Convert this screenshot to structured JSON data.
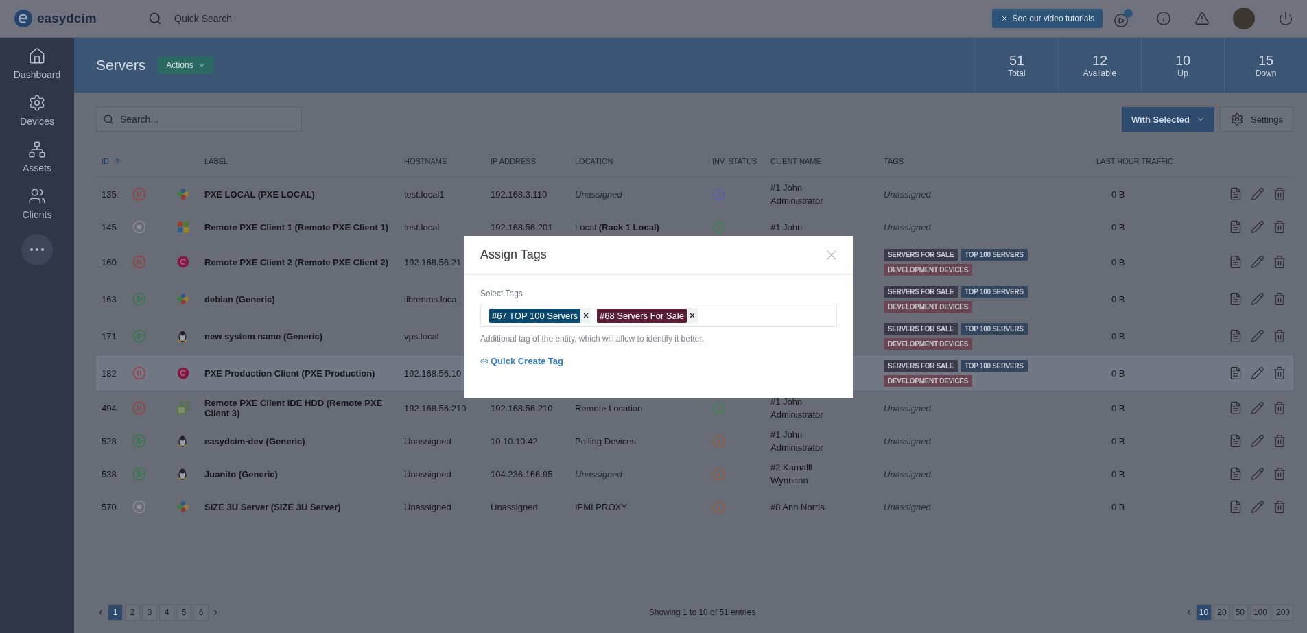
{
  "topbar": {
    "logo": "easydcim",
    "search": {
      "placeholder": "Quick Search"
    },
    "tutorial_button": "See our video tutorials"
  },
  "sidebar": {
    "items": [
      {
        "label": "Dashboard",
        "kind": "home"
      },
      {
        "label": "Devices",
        "kind": "gear"
      },
      {
        "label": "Assets",
        "kind": "network"
      },
      {
        "label": "Clients",
        "kind": "users"
      }
    ]
  },
  "page_header": {
    "title": "Servers",
    "actions_button": "Actions",
    "stats": [
      {
        "value": "51",
        "label": "Total"
      },
      {
        "value": "12",
        "label": "Available"
      },
      {
        "value": "10",
        "label": "Up"
      },
      {
        "value": "15",
        "label": "Down"
      }
    ]
  },
  "toolbar": {
    "search": {
      "placeholder": "Search..."
    },
    "with_selected_button": "With Selected",
    "settings_button": "Settings"
  },
  "table": {
    "columns": [
      {
        "label": "ID",
        "sorted": true,
        "kind": "id"
      },
      {
        "label": "LABEL",
        "sorted": false,
        "kind": "label"
      },
      {
        "label": "HOSTNAME",
        "sorted": false,
        "kind": "hostname"
      },
      {
        "label": "IP ADDRESS",
        "sorted": false,
        "kind": "ip"
      },
      {
        "label": "LOCATION",
        "sorted": false,
        "kind": "location"
      },
      {
        "label": "INV. STATUS",
        "sorted": false,
        "kind": "inv"
      },
      {
        "label": "CLIENT NAME",
        "sorted": false,
        "kind": "client"
      },
      {
        "label": "TAGS",
        "sorted": false,
        "kind": "tags"
      },
      {
        "label": "LAST HOUR TRAFFIC",
        "sorted": false,
        "kind": "traffic"
      }
    ],
    "rows": [
      {
        "id": "135",
        "status_icon": {
          "kind": "paused"
        },
        "os_icon": {
          "kind": "pinwheel"
        },
        "label": "PXE LOCAL (PXE LOCAL)",
        "hostname": "test.local1",
        "ip": "192.168.3.110",
        "location": "Unassigned",
        "location_assigned": false,
        "inv_status": {
          "color": "#5b57c9"
        },
        "client": "#1 John Administrator",
        "tags": [],
        "tags_empty": "Unassigned",
        "traffic": "0 B",
        "highlighted": false
      },
      {
        "id": "145",
        "status_icon": {
          "kind": "stopped"
        },
        "os_icon": {
          "kind": "windows"
        },
        "label": "Remote PXE Client 1 (Remote PXE Client 1)",
        "hostname": "test.local",
        "ip": "192.168.56.201",
        "location": "Local **(Rack 1 Local)**",
        "location_assigned": true,
        "inv_status": {
          "color": "#2e8a48"
        },
        "client": "#1 John",
        "tags": [],
        "tags_empty": "Unassigned",
        "traffic": "0 B",
        "highlighted": false
      },
      {
        "id": "160",
        "status_icon": {
          "kind": "paused"
        },
        "os_icon": {
          "kind": "swirl"
        },
        "label": "Remote PXE Client 2 (Remote PXE Client 2)",
        "hostname": "192.168.56.21",
        "tags": [
          {
            "label": "SERVERS FOR SALE",
            "color": "#3b3a4b"
          },
          {
            "label": "TOP 100 SERVERS",
            "color": "#33465f"
          },
          {
            "label": "DEVELOPMENT DEVICES",
            "color": "#6b4652"
          }
        ],
        "traffic": "0 B",
        "highlighted": false
      },
      {
        "id": "163",
        "status_icon": {
          "kind": "running"
        },
        "os_icon": {
          "kind": "pinwheel"
        },
        "label": "debian (Generic)",
        "hostname": "librenms.loca",
        "tags": [
          {
            "label": "SERVERS FOR SALE",
            "color": "#3b3a4b"
          },
          {
            "label": "TOP 100 SERVERS",
            "color": "#33465f"
          },
          {
            "label": "DEVELOPMENT DEVICES",
            "color": "#6b4652"
          }
        ],
        "traffic": "0 B",
        "highlighted": false
      },
      {
        "id": "171",
        "status_icon": {
          "kind": "running"
        },
        "os_icon": {
          "kind": "penguin"
        },
        "label": "new system name (Generic)",
        "hostname": "vps.local",
        "tags": [
          {
            "label": "SERVERS FOR SALE",
            "color": "#3b3a4b"
          },
          {
            "label": "TOP 100 SERVERS",
            "color": "#33465f"
          },
          {
            "label": "DEVELOPMENT DEVICES",
            "color": "#6b4652"
          }
        ],
        "traffic": "0 B",
        "highlighted": false
      },
      {
        "id": "182",
        "status_icon": {
          "kind": "paused"
        },
        "os_icon": {
          "kind": "swirl"
        },
        "label": "PXE Production Client (PXE Production)",
        "hostname": "192.168.56.10",
        "tags": [
          {
            "label": "SERVERS FOR SALE",
            "color": "#3b3a4b"
          },
          {
            "label": "TOP 100 SERVERS",
            "color": "#33465f"
          },
          {
            "label": "DEVELOPMENT DEVICES",
            "color": "#6b4652"
          }
        ],
        "traffic": "0 B",
        "highlighted": true
      },
      {
        "id": "494",
        "status_icon": {
          "kind": "paused"
        },
        "os_icon": {
          "kind": "squares"
        },
        "label": "Remote PXE Client IDE HDD (Remote PXE Client 3)",
        "hostname": "192.168.56.210",
        "ip": "192.168.56.210",
        "location": "Remote Location",
        "location_assigned": true,
        "inv_status": {
          "color": "#2e8a48"
        },
        "client": "#1 John Administrator",
        "tags": [],
        "tags_empty": "Unassigned",
        "traffic": "0 B",
        "highlighted": false
      },
      {
        "id": "528",
        "status_icon": {
          "kind": "running"
        },
        "os_icon": {
          "kind": "penguin"
        },
        "label": "easydcim-dev (Generic)",
        "hostname": "Unassigned",
        "ip": "10.10.10.42",
        "location": "Polling Devices",
        "location_assigned": true,
        "inv_status": {
          "color": "#a8542a"
        },
        "client": "#1 John Administrator",
        "tags": [],
        "tags_empty": "Unassigned",
        "traffic": "0 B",
        "highlighted": false
      },
      {
        "id": "538",
        "status_icon": {
          "kind": "running"
        },
        "os_icon": {
          "kind": "penguin"
        },
        "label": "Juanito (Generic)",
        "hostname": "Unassigned",
        "ip": "104.236.166.95",
        "location": "Unassigned",
        "location_assigned": false,
        "inv_status": {
          "color": "#a8542a"
        },
        "client": "#2 Kamalll Wynnnnn",
        "tags": [],
        "tags_empty": "Unassigned",
        "traffic": "0 B",
        "highlighted": false
      },
      {
        "id": "570",
        "status_icon": {
          "kind": "stopped"
        },
        "os_icon": {
          "kind": "pinwheel"
        },
        "label": "SIZE 3U Server (SIZE 3U Server)",
        "hostname": "Unassigned",
        "ip": "Unassigned",
        "location": "IPMI PROXY",
        "location_assigned": true,
        "inv_status": {
          "color": "#a8542a"
        },
        "client": "#8 Ann Norris",
        "tags": [],
        "tags_empty": "Unassigned",
        "traffic": "0 B",
        "highlighted": false
      }
    ]
  },
  "pagination": {
    "pages": [
      {
        "label": "1",
        "selected": true
      },
      {
        "label": "2",
        "selected": false
      },
      {
        "label": "3",
        "selected": false
      },
      {
        "label": "4",
        "selected": false
      },
      {
        "label": "5",
        "selected": false
      },
      {
        "label": "6",
        "selected": false
      }
    ],
    "info": "Showing 1 to 10 of 51 entries",
    "page_sizes": [
      {
        "label": "10",
        "selected": true
      },
      {
        "label": "20",
        "selected": false
      },
      {
        "label": "50",
        "selected": false
      },
      {
        "label": "100",
        "selected": false
      },
      {
        "label": "200",
        "selected": false
      }
    ]
  },
  "modal": {
    "title": "Assign Tags",
    "field_label": "Select Tags",
    "chips": [
      {
        "label": "#67 TOP 100 Servers",
        "color": "#0b4a6e"
      },
      {
        "label": "#68 Servers For Sale",
        "color": "#5a1f35"
      }
    ],
    "help": "Additional tag of the entity, which will allow to identify it better.",
    "link": "Quick Create Tag"
  }
}
